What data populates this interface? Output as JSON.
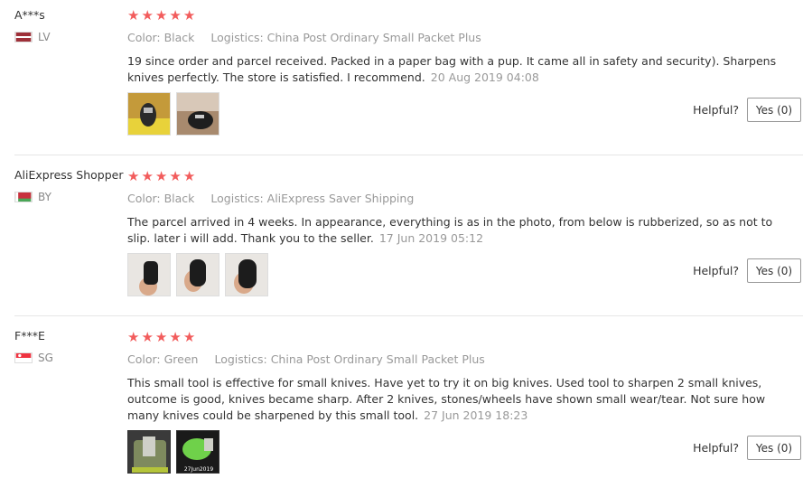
{
  "reviews": [
    {
      "user": "A***s",
      "country": "LV",
      "flag": "latvia-flag",
      "rating": 5,
      "color_label": "Color: Black",
      "logistics_label": "Logistics: China Post Ordinary Small Packet Plus",
      "text": "19 since order and parcel received. Packed in a paper bag with a pup. It came all in safety and security). Sharpens knives perfectly. The store is satisfied. I recommend.",
      "date": "20 Aug 2019 04:08",
      "photos": 2,
      "helpful_label": "Helpful?",
      "yes_label": "Yes (0)"
    },
    {
      "user": "AliExpress Shopper",
      "country": "BY",
      "flag": "belarus-flag",
      "rating": 5,
      "color_label": "Color: Black",
      "logistics_label": "Logistics: AliExpress Saver Shipping",
      "text": "The parcel arrived in 4 weeks. In appearance, everything is as in the photo, from below is rubberized, so as not to slip. later i will add. Thank you to the seller.",
      "date": "17 Jun 2019 05:12",
      "photos": 3,
      "helpful_label": "Helpful?",
      "yes_label": "Yes (0)"
    },
    {
      "user": "F***E",
      "country": "SG",
      "flag": "singapore-flag",
      "rating": 5,
      "color_label": "Color: Green",
      "logistics_label": "Logistics: China Post Ordinary Small Packet Plus",
      "text": "This small tool is effective for small knives. Have yet to try it on big knives. Used tool to sharpen 2 small knives, outcome is good, knives became sharp. After 2 knives, stones/wheels have shown small wear/tear. Not sure how many knives could be sharpened by this small tool.",
      "date": "27 Jun 2019 18:23",
      "photos": 2,
      "photo_stamp": "27Jun2019",
      "helpful_label": "Helpful?",
      "yes_label": "Yes (0)"
    }
  ]
}
